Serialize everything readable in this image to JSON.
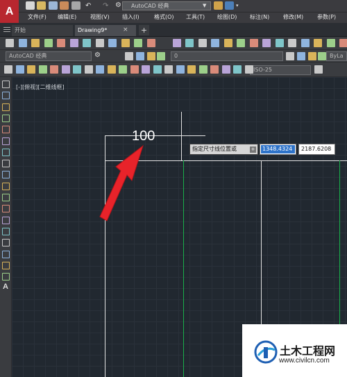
{
  "app": {
    "logo_letter": "A",
    "window_title": "AutoCAD 经典"
  },
  "menu_items": [
    "文件(F)",
    "编辑(E)",
    "视图(V)",
    "插入(I)",
    "格式(O)",
    "工具(T)",
    "绘图(D)",
    "标注(N)",
    "修改(M)",
    "参数(P)"
  ],
  "tabs": {
    "start": "开始",
    "drawing": "Drawing9*",
    "close": "×",
    "add": "+"
  },
  "toolbars": {
    "workspace_combo": "AutoCAD 经典",
    "layer_combo": "0",
    "linetype_combo": "ByLa",
    "dimstyle_combo": "ISO-25"
  },
  "canvas": {
    "view_label": "[-][俯视][二维线框]",
    "dimension_value": "100"
  },
  "dynamic_input": {
    "prompt": "指定尺寸线位置或",
    "lock_glyph": "+",
    "x_value": "1348.4324",
    "y_value": "2187.6208"
  },
  "watermark": {
    "title": "土木工程网",
    "url": "www.civilcn.com"
  },
  "colors": {
    "app_red": "#b8272f",
    "canvas_bg": "#212830",
    "dimension_line": "#e5e5e5",
    "green_line": "#19b04a",
    "arrow_red": "#e8232a",
    "selection_blue": "#2e73c9"
  }
}
